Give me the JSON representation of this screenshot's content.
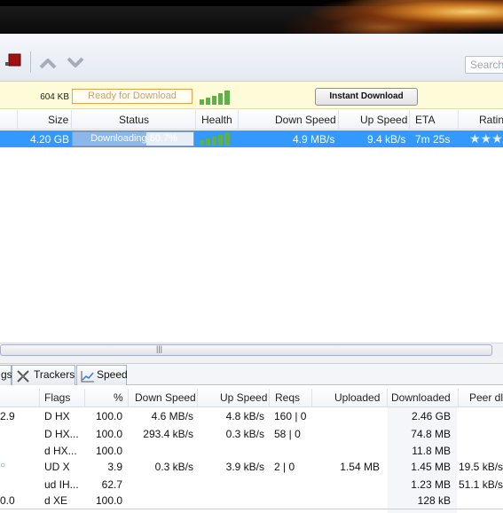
{
  "search": {
    "placeholder": "Search"
  },
  "infobar": {
    "size": "604 KB",
    "status_box": "Ready for Download",
    "instant_button": "Instant Download"
  },
  "top_table": {
    "headers": [
      "Size",
      "Status",
      "Health",
      "Down Speed",
      "Up Speed",
      "ETA",
      "Ratin"
    ],
    "row": {
      "size": "4.20 GB",
      "status": "Downloading 60.7%",
      "progress": 0.607,
      "down_speed": "4.9 MB/s",
      "up_speed": "9.4 kB/s",
      "eta": "7m 25s",
      "rating_stars": "★★★"
    }
  },
  "tabs": [
    {
      "label": "gs",
      "icon": ""
    },
    {
      "label": "Trackers",
      "icon": "trackers-icon"
    },
    {
      "label": "Speed",
      "icon": "speed-chart-icon"
    }
  ],
  "scroll_grip": "|||",
  "peers": {
    "headers": [
      "Flags",
      "%",
      "Down Speed",
      "Up Speed",
      "Reqs",
      "Uploaded",
      "Downloaded",
      "Peer dl."
    ],
    "rows": [
      {
        "col0": "2.9",
        "flags": "D HX",
        "pct": "100.0",
        "down": "4.6 MB/s",
        "up": "4.8 kB/s",
        "reqs": "160 | 0",
        "uploaded": "",
        "downloaded": "2.46 GB",
        "peer_dl": ""
      },
      {
        "col0": "",
        "flags": "D HX...",
        "pct": "100.0",
        "down": "293.4 kB/s",
        "up": "0.3 kB/s",
        "reqs": "58 | 0",
        "uploaded": "",
        "downloaded": "74.8 MB",
        "peer_dl": ""
      },
      {
        "col0": "",
        "flags": "d HX...",
        "pct": "100.0",
        "down": "",
        "up": "",
        "reqs": "",
        "uploaded": "",
        "downloaded": "11.8 MB",
        "peer_dl": ""
      },
      {
        "col0": "",
        "flags": "UD X",
        "pct": "3.9",
        "down": "0.3 kB/s",
        "up": "3.9 kB/s",
        "reqs": "2 | 0",
        "uploaded": "1.54 MB",
        "downloaded": "1.45 MB",
        "peer_dl": "19.5 kB/s"
      },
      {
        "col0": "",
        "flags": "ud IH...",
        "pct": "62.7",
        "down": "",
        "up": "",
        "reqs": "",
        "uploaded": "",
        "downloaded": "1.23 MB",
        "peer_dl": "51.1 kB/s"
      },
      {
        "col0": "0.0",
        "flags": "d XE",
        "pct": "100.0",
        "down": "",
        "up": "",
        "reqs": "",
        "uploaded": "",
        "downloaded": "128 kB",
        "peer_dl": ""
      }
    ]
  }
}
